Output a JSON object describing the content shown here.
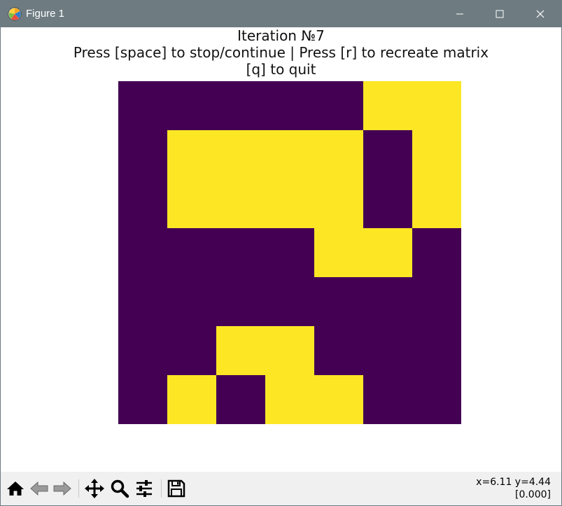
{
  "window": {
    "title": "Figure 1"
  },
  "figure": {
    "title_line1": "Iteration №7",
    "title_line2": "Press [space] to stop/continue | Press [r] to recreate matrix",
    "title_line3": "[q] to quit"
  },
  "colors": {
    "off": "#440154",
    "on": "#fde725"
  },
  "chart_data": {
    "type": "heatmap",
    "rows": 7,
    "cols": 7,
    "values": [
      [
        0,
        0,
        0,
        0,
        0,
        1,
        1
      ],
      [
        0,
        1,
        1,
        1,
        1,
        0,
        1
      ],
      [
        0,
        1,
        1,
        1,
        1,
        0,
        1
      ],
      [
        0,
        0,
        0,
        0,
        1,
        1,
        0
      ],
      [
        0,
        0,
        0,
        0,
        0,
        0,
        0
      ],
      [
        0,
        0,
        1,
        1,
        0,
        0,
        0
      ],
      [
        0,
        1,
        0,
        1,
        1,
        0,
        0
      ]
    ]
  },
  "toolbar": {
    "icons": [
      "home-icon",
      "back-arrow-icon",
      "forward-arrow-icon",
      "pan-icon",
      "zoom-icon",
      "configure-subplots-icon",
      "save-icon"
    ],
    "status_line1": "x=6.11 y=4.44",
    "status_line2": "[0.000]"
  }
}
